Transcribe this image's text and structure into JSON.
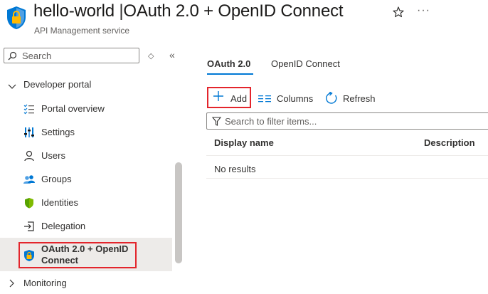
{
  "header": {
    "title": "hello-world",
    "separator": "|",
    "page_title": "OAuth 2.0 + OpenID Connect",
    "subtitle": "API Management service",
    "favorite_icon": "star-icon",
    "more_icon": "ellipsis-icon",
    "more_text": "···"
  },
  "sidebar": {
    "search_placeholder": "Search",
    "toggle_glyph": "◇",
    "collapse_glyph": "«",
    "group": {
      "label": "Developer portal",
      "expanded": true
    },
    "items": [
      {
        "label": "Portal overview",
        "icon": "list-check-icon"
      },
      {
        "label": "Settings",
        "icon": "sliders-icon"
      },
      {
        "label": "Users",
        "icon": "user-icon"
      },
      {
        "label": "Groups",
        "icon": "groups-icon"
      },
      {
        "label": "Identities",
        "icon": "shield-icon"
      },
      {
        "label": "Delegation",
        "icon": "delegation-icon"
      }
    ],
    "selected": {
      "label_line1": "OAuth 2.0 + OpenID",
      "label_line2": "Connect",
      "icon": "lock-shield-icon"
    },
    "monitoring": {
      "label": "Monitoring",
      "expanded": false
    }
  },
  "main": {
    "tabs": [
      {
        "label": "OAuth 2.0",
        "active": true
      },
      {
        "label": "OpenID Connect",
        "active": false
      }
    ],
    "toolbar": {
      "add_label": "Add",
      "columns_label": "Columns",
      "refresh_label": "Refresh"
    },
    "filter_placeholder": "Search to filter items...",
    "table": {
      "columns": [
        "Display name",
        "Description"
      ],
      "empty_text": "No results"
    }
  },
  "colors": {
    "accent": "#0078d4",
    "highlight": "#e3252c",
    "selected_bg": "#edebe9"
  }
}
